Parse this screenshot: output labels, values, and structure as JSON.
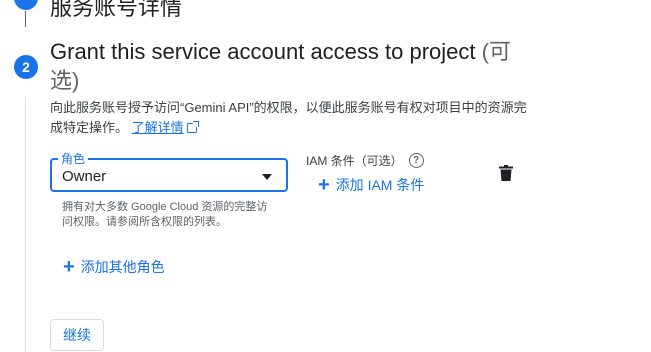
{
  "step1": {
    "title": "服务账号详情"
  },
  "step2": {
    "number": "2",
    "title": "Grant this service account access to project",
    "optional": "(可选)",
    "description": "向此服务账号授予访问“Gemini API”的权限，以便此服务账号有权对项目中的资源完成特定操作。",
    "learn_more": "了解详情"
  },
  "role_field": {
    "label": "角色",
    "value": "Owner",
    "hint": "拥有对大多数 Google Cloud 资源的完整访问权限。请参阅所含权限的列表。"
  },
  "iam_condition": {
    "label": "IAM 条件（可选）",
    "help_icon": "?",
    "add_label": "添加 IAM 条件"
  },
  "add_role_label": "添加其他角色",
  "continue_label": "继续",
  "icons": {
    "plus": "+",
    "delete": "trash-icon",
    "external": "external-link-icon",
    "dropdown": "arrow-drop-down-icon"
  },
  "colors": {
    "accent": "#1a73e8",
    "text": "#202124",
    "muted": "#5f6368"
  }
}
